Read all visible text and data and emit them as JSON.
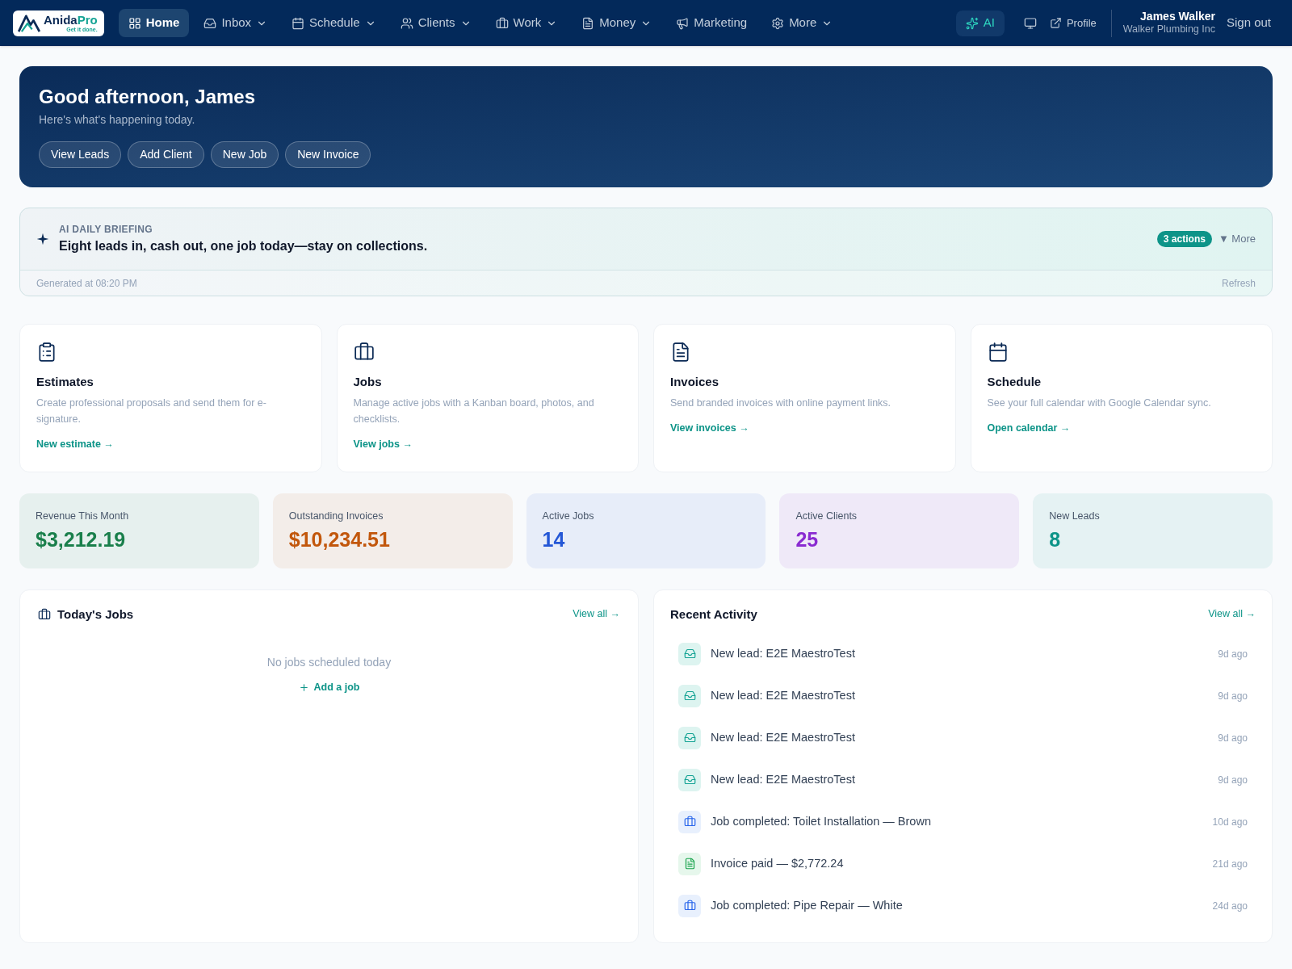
{
  "nav": {
    "logo": {
      "name": "Anida",
      "accent": "Pro",
      "tagline": "Get it done."
    },
    "items": [
      {
        "label": "Home",
        "selected": true,
        "dropdown": false
      },
      {
        "label": "Inbox",
        "selected": false,
        "dropdown": true
      },
      {
        "label": "Schedule",
        "selected": false,
        "dropdown": true
      },
      {
        "label": "Clients",
        "selected": false,
        "dropdown": true
      },
      {
        "label": "Work",
        "selected": false,
        "dropdown": true
      },
      {
        "label": "Money",
        "selected": false,
        "dropdown": true
      },
      {
        "label": "Marketing",
        "selected": false,
        "dropdown": false
      },
      {
        "label": "More",
        "selected": false,
        "dropdown": true
      }
    ],
    "ai_button": "AI",
    "profile_link": "Profile",
    "user": {
      "name": "James Walker",
      "company": "Walker Plumbing Inc"
    },
    "sign_out": "Sign out"
  },
  "hero": {
    "greeting": "Good afternoon, James",
    "subtitle": "Here's what's happening today.",
    "actions": [
      "View Leads",
      "Add Client",
      "New Job",
      "New Invoice"
    ]
  },
  "briefing": {
    "label": "AI DAILY BRIEFING",
    "summary": "Eight leads in, cash out, one job today—stay on collections.",
    "badge": "3 actions",
    "more": "▼ More",
    "generated": "Generated at 08:20 PM",
    "refresh": "Refresh"
  },
  "features": [
    {
      "title": "Estimates",
      "description": "Create professional proposals and send them for e-signature.",
      "link": "New estimate →"
    },
    {
      "title": "Jobs",
      "description": "Manage active jobs with a Kanban board, photos, and checklists.",
      "link": "View jobs →"
    },
    {
      "title": "Invoices",
      "description": "Send branded invoices with online payment links.",
      "link": "View invoices →"
    },
    {
      "title": "Schedule",
      "description": "See your full calendar with Google Calendar sync.",
      "link": "Open calendar →"
    }
  ],
  "stats": [
    {
      "label": "Revenue This Month",
      "value": "$3,212.19",
      "color": "#1a7f4b"
    },
    {
      "label": "Outstanding Invoices",
      "value": "$10,234.51",
      "color": "#c2570c"
    },
    {
      "label": "Active Jobs",
      "value": "14",
      "color": "#2457d6"
    },
    {
      "label": "Active Clients",
      "value": "25",
      "color": "#8a2bd1"
    },
    {
      "label": "New Leads",
      "value": "8",
      "color": "#0d9488"
    }
  ],
  "todays_jobs": {
    "title": "Today's Jobs",
    "view_all": "View all →",
    "empty": "No jobs scheduled today",
    "add": "Add a job"
  },
  "recent_activity": {
    "title": "Recent Activity",
    "view_all": "View all →",
    "items": [
      {
        "kind": "lead",
        "text": "New lead: E2E MaestroTest",
        "time": "9d ago"
      },
      {
        "kind": "lead",
        "text": "New lead: E2E MaestroTest",
        "time": "9d ago"
      },
      {
        "kind": "lead",
        "text": "New lead: E2E MaestroTest",
        "time": "9d ago"
      },
      {
        "kind": "lead",
        "text": "New lead: E2E MaestroTest",
        "time": "9d ago"
      },
      {
        "kind": "job",
        "text": "Job completed: Toilet Installation — Brown",
        "time": "10d ago"
      },
      {
        "kind": "invoice",
        "text": "Invoice paid — $2,772.24",
        "time": "21d ago"
      },
      {
        "kind": "job",
        "text": "Job completed: Pipe Repair — White",
        "time": "24d ago"
      }
    ]
  }
}
